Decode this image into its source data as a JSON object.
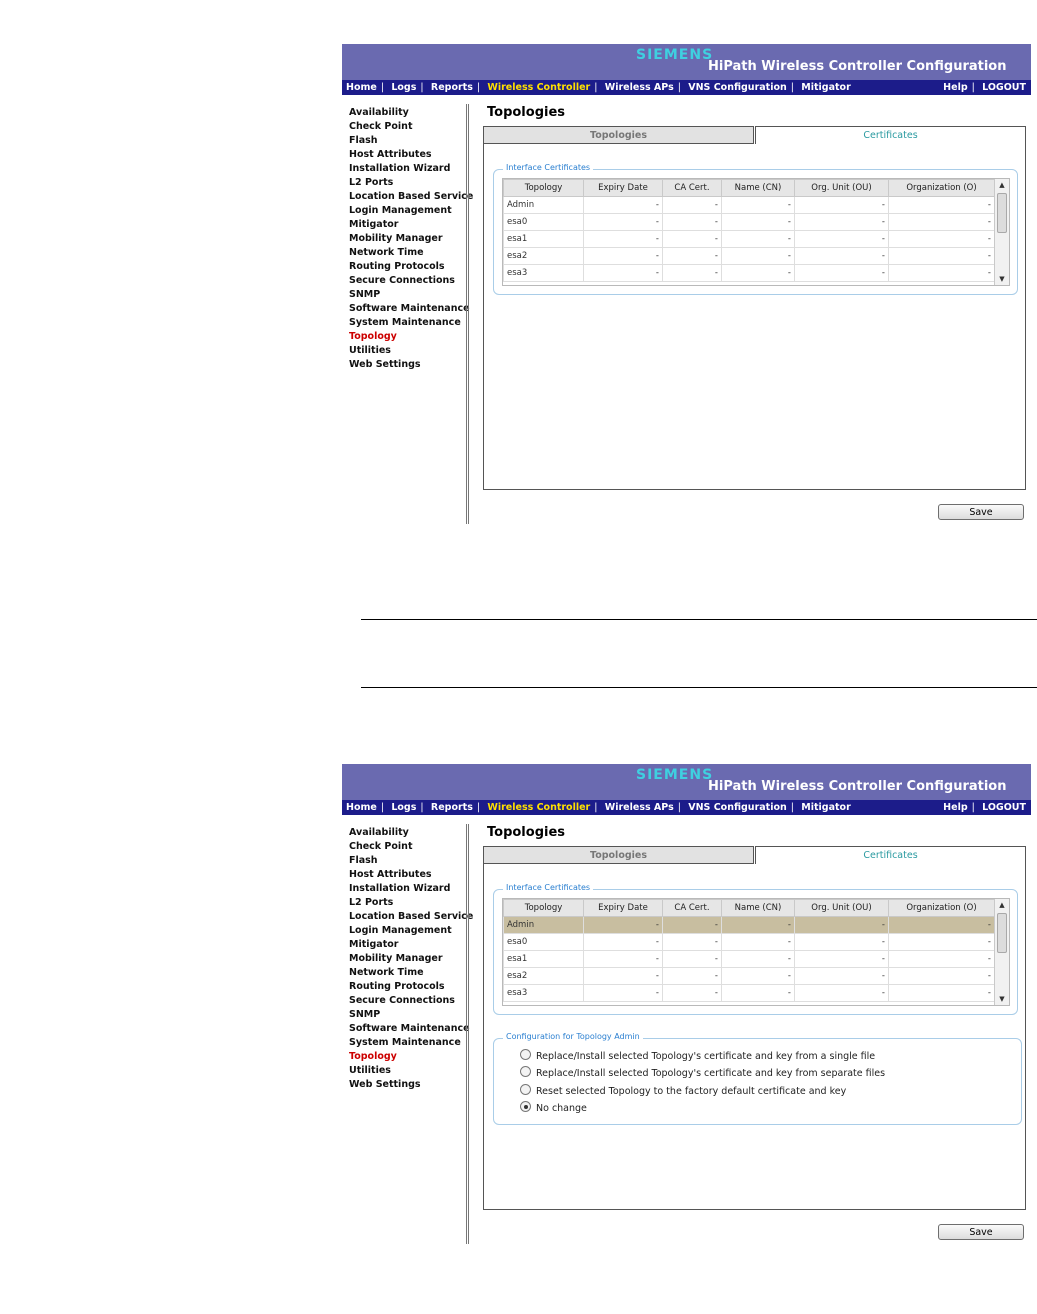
{
  "brand": "SIEMENS",
  "app_title": "HiPath Wireless Controller Configuration",
  "nav": {
    "items": [
      "Home",
      "Logs",
      "Reports",
      "Wireless Controller",
      "Wireless APs",
      "VNS Configuration",
      "Mitigator"
    ],
    "active": "Wireless Controller",
    "right": [
      "Help",
      "LOGOUT"
    ]
  },
  "sidebar": {
    "items": [
      "Availability",
      "Check Point",
      "Flash",
      "Host Attributes",
      "Installation Wizard",
      "L2 Ports",
      "Location Based Service",
      "Login Management",
      "Mitigator",
      "Mobility Manager",
      "Network Time",
      "Routing Protocols",
      "Secure Connections",
      "SNMP",
      "Software Maintenance",
      "System Maintenance",
      "Topology",
      "Utilities",
      "Web Settings"
    ],
    "active": "Topology"
  },
  "page_title": "Topologies",
  "tabs": [
    "Topologies",
    "Certificates"
  ],
  "active_tab": "Certificates",
  "certs_legend": "Interface Certificates",
  "table": {
    "columns": [
      "Topology",
      "Expiry Date",
      "CA Cert.",
      "Name (CN)",
      "Org. Unit (OU)",
      "Organization (O)"
    ],
    "rows": [
      [
        "Admin",
        "-",
        "-",
        "-",
        "-",
        "-"
      ],
      [
        "esa0",
        "-",
        "-",
        "-",
        "-",
        "-"
      ],
      [
        "esa1",
        "-",
        "-",
        "-",
        "-",
        "-"
      ],
      [
        "esa2",
        "-",
        "-",
        "-",
        "-",
        "-"
      ],
      [
        "esa3",
        "-",
        "-",
        "-",
        "-",
        "-"
      ]
    ]
  },
  "config": {
    "legend": "Configuration for Topology Admin",
    "options": [
      "Replace/Install selected Topology's certificate and key from a single file",
      "Replace/Install selected Topology's certificate and key from separate files",
      "Reset selected Topology to the factory default certificate and key",
      "No change"
    ],
    "selected": "No change"
  },
  "save_label": "Save",
  "colors": {
    "banner": "#6a6ab0",
    "navbar": "#1c1c8a",
    "nav_active": "#ffe000",
    "sidebar_active": "#cc0000",
    "tab_active_text": "#2a9aa0",
    "legend_text": "#2a7fd0",
    "selected_row": "#c8bea0"
  }
}
